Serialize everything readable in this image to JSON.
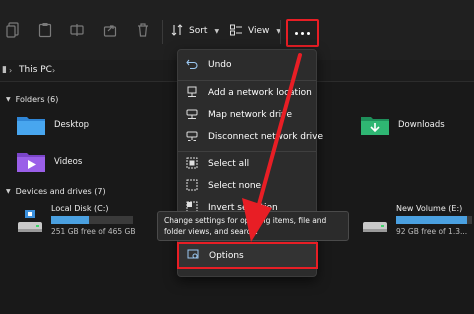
{
  "toolbar": {
    "sort_label": "Sort",
    "view_label": "View",
    "more_icon": "ellipsis-icon"
  },
  "address": {
    "path": "This PC"
  },
  "folders": {
    "header": "Folders (6)",
    "items": [
      {
        "name": "Desktop",
        "icon": "desktop-folder-icon"
      },
      {
        "name": "Videos",
        "icon": "videos-folder-icon"
      },
      {
        "name": "Downloads",
        "icon": "downloads-folder-icon"
      }
    ]
  },
  "devices": {
    "header": "Devices and drives (7)",
    "drives": [
      {
        "name": "Local Disk (C:)",
        "free_text": "251 GB free of 465 GB",
        "used_fraction": 0.46
      },
      {
        "name": "New Volume (E:)",
        "free_text": "92 GB free of 1.3...",
        "used_fraction": 0.93
      }
    ]
  },
  "menu": {
    "items": [
      {
        "label": "Undo",
        "icon": "undo-icon"
      },
      {
        "label": "Add a network location",
        "icon": "add-network-location-icon"
      },
      {
        "label": "Map network drive",
        "icon": "map-network-drive-icon"
      },
      {
        "label": "Disconnect network drive",
        "icon": "disconnect-network-drive-icon"
      },
      {
        "label": "Select all",
        "icon": "select-all-icon"
      },
      {
        "label": "Select none",
        "icon": "select-none-icon"
      },
      {
        "label": "Invert selection",
        "icon": "invert-selection-icon"
      }
    ],
    "options_label": "Options"
  },
  "tooltip": {
    "text": "Change settings for opening items, file and folder views, and search."
  },
  "colors": {
    "highlight": "#e81e25",
    "accent": "#4aa0e0"
  }
}
